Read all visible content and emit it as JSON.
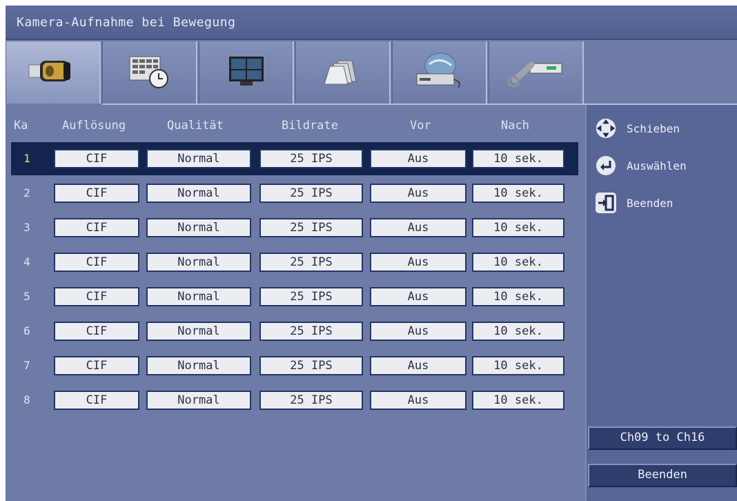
{
  "title": "Kamera-Aufnahme bei Bewegung",
  "tabs": [
    {
      "icon": "camera-icon",
      "active": true
    },
    {
      "icon": "schedule-icon",
      "active": false
    },
    {
      "icon": "monitor-icon",
      "active": false
    },
    {
      "icon": "archive-icon",
      "active": false
    },
    {
      "icon": "network-icon",
      "active": false
    },
    {
      "icon": "tools-icon",
      "active": false
    }
  ],
  "table": {
    "headers": {
      "ka": "Ka",
      "aufloesung": "Auflösung",
      "qualitaet": "Qualität",
      "bildrate": "Bildrate",
      "vor": "Vor",
      "nach": "Nach"
    },
    "selected_row": 0,
    "rows": [
      {
        "ka": "1",
        "aufloesung": "CIF",
        "qualitaet": "Normal",
        "bildrate": "25 IPS",
        "vor": "Aus",
        "nach": "10 sek."
      },
      {
        "ka": "2",
        "aufloesung": "CIF",
        "qualitaet": "Normal",
        "bildrate": "25 IPS",
        "vor": "Aus",
        "nach": "10 sek."
      },
      {
        "ka": "3",
        "aufloesung": "CIF",
        "qualitaet": "Normal",
        "bildrate": "25 IPS",
        "vor": "Aus",
        "nach": "10 sek."
      },
      {
        "ka": "4",
        "aufloesung": "CIF",
        "qualitaet": "Normal",
        "bildrate": "25 IPS",
        "vor": "Aus",
        "nach": "10 sek."
      },
      {
        "ka": "5",
        "aufloesung": "CIF",
        "qualitaet": "Normal",
        "bildrate": "25 IPS",
        "vor": "Aus",
        "nach": "10 sek."
      },
      {
        "ka": "6",
        "aufloesung": "CIF",
        "qualitaet": "Normal",
        "bildrate": "25 IPS",
        "vor": "Aus",
        "nach": "10 sek."
      },
      {
        "ka": "7",
        "aufloesung": "CIF",
        "qualitaet": "Normal",
        "bildrate": "25 IPS",
        "vor": "Aus",
        "nach": "10 sek."
      },
      {
        "ka": "8",
        "aufloesung": "CIF",
        "qualitaet": "Normal",
        "bildrate": "25 IPS",
        "vor": "Aus",
        "nach": "10 sek."
      }
    ]
  },
  "sidebar": {
    "legend": [
      {
        "icon": "dpad-icon",
        "label": "Schieben"
      },
      {
        "icon": "enter-icon",
        "label": "Auswählen"
      },
      {
        "icon": "exit-icon",
        "label": "Beenden"
      }
    ],
    "channel_button": "Ch09 to Ch16",
    "exit_button": "Beenden"
  },
  "colors": {
    "background": "#6d7ba6",
    "selected_row": "#13254f",
    "selected_number": "#e8e17a",
    "field": "#ecedf1"
  }
}
